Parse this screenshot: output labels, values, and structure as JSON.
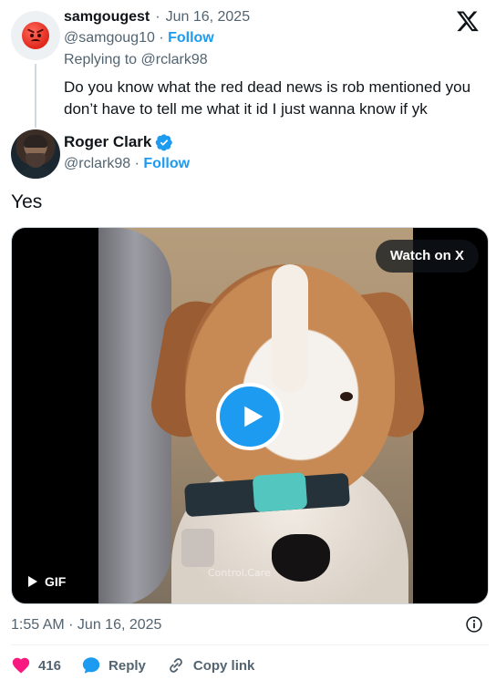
{
  "parent_tweet": {
    "display_name": "samgougest",
    "date": "Jun 16, 2025",
    "handle": "@samgoug10",
    "follow_label": "Follow",
    "replying_prefix": "Replying to",
    "replying_handle": "@rclark98",
    "text": "Do you know what the red dead news is rob mentioned you don’t have to tell me what it id I just wanna know if yk",
    "avatar_icon": "angry-face-emoji"
  },
  "tweet": {
    "display_name": "Roger Clark",
    "handle": "@rclark98",
    "follow_label": "Follow",
    "text": "Yes",
    "timestamp": "1:55 AM · Jun 16, 2025"
  },
  "media": {
    "watch_label": "Watch on X",
    "badge_label": "GIF",
    "watermark": "Control.Care"
  },
  "actions": {
    "like_count": "416",
    "reply_label": "Reply",
    "copy_link_label": "Copy link"
  },
  "colors": {
    "accent": "#1d9bf0",
    "like": "#f91880",
    "muted": "#536471"
  }
}
